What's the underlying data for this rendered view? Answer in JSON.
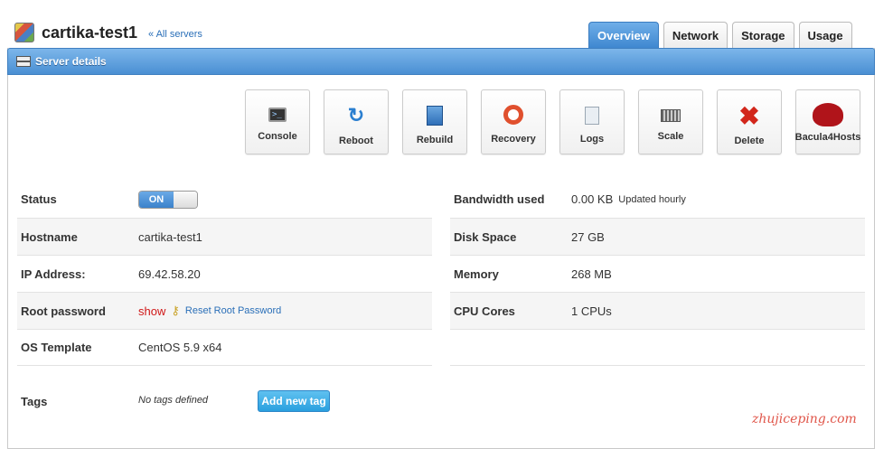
{
  "server": {
    "name": "cartika-test1",
    "all_servers_link": "« All servers"
  },
  "tabs": [
    {
      "label": "Overview",
      "active": true
    },
    {
      "label": "Network",
      "active": false
    },
    {
      "label": "Storage",
      "active": false
    },
    {
      "label": "Usage",
      "active": false
    }
  ],
  "panel": {
    "title": "Server details"
  },
  "actions": [
    {
      "label": "Console",
      "icon": "console-icon"
    },
    {
      "label": "Reboot",
      "icon": "reboot-icon"
    },
    {
      "label": "Rebuild",
      "icon": "rebuild-icon"
    },
    {
      "label": "Recovery",
      "icon": "recovery-icon"
    },
    {
      "label": "Logs",
      "icon": "logs-icon"
    },
    {
      "label": "Scale",
      "icon": "scale-icon"
    },
    {
      "label": "Delete",
      "icon": "delete-icon"
    },
    {
      "label": "Bacula4Hosts",
      "icon": "bacula-icon"
    }
  ],
  "left": {
    "status_label": "Status",
    "status_toggle": "ON",
    "hostname_label": "Hostname",
    "hostname_value": "cartika-test1",
    "ip_label": "IP Address:",
    "ip_value": "69.42.58.20",
    "root_label": "Root password",
    "root_show": "show",
    "root_reset": "Reset Root Password",
    "os_label": "OS Template",
    "os_value": "CentOS 5.9 x64"
  },
  "right": {
    "bandwidth_label": "Bandwidth used",
    "bandwidth_value": "0.00 KB",
    "bandwidth_note": "Updated hourly",
    "disk_label": "Disk Space",
    "disk_value": "27 GB",
    "memory_label": "Memory",
    "memory_value": "268 MB",
    "cpu_label": "CPU Cores",
    "cpu_value": "1 CPUs"
  },
  "tags": {
    "label": "Tags",
    "value": "No tags defined",
    "add_button": "Add new tag"
  },
  "watermark": "zhujiceping.com",
  "colors": {
    "accent": "#4a8fd3",
    "tab_active": "#3d86cf",
    "delete": "#d2261b",
    "show_link": "#d01818",
    "button": "#2aa0df"
  }
}
